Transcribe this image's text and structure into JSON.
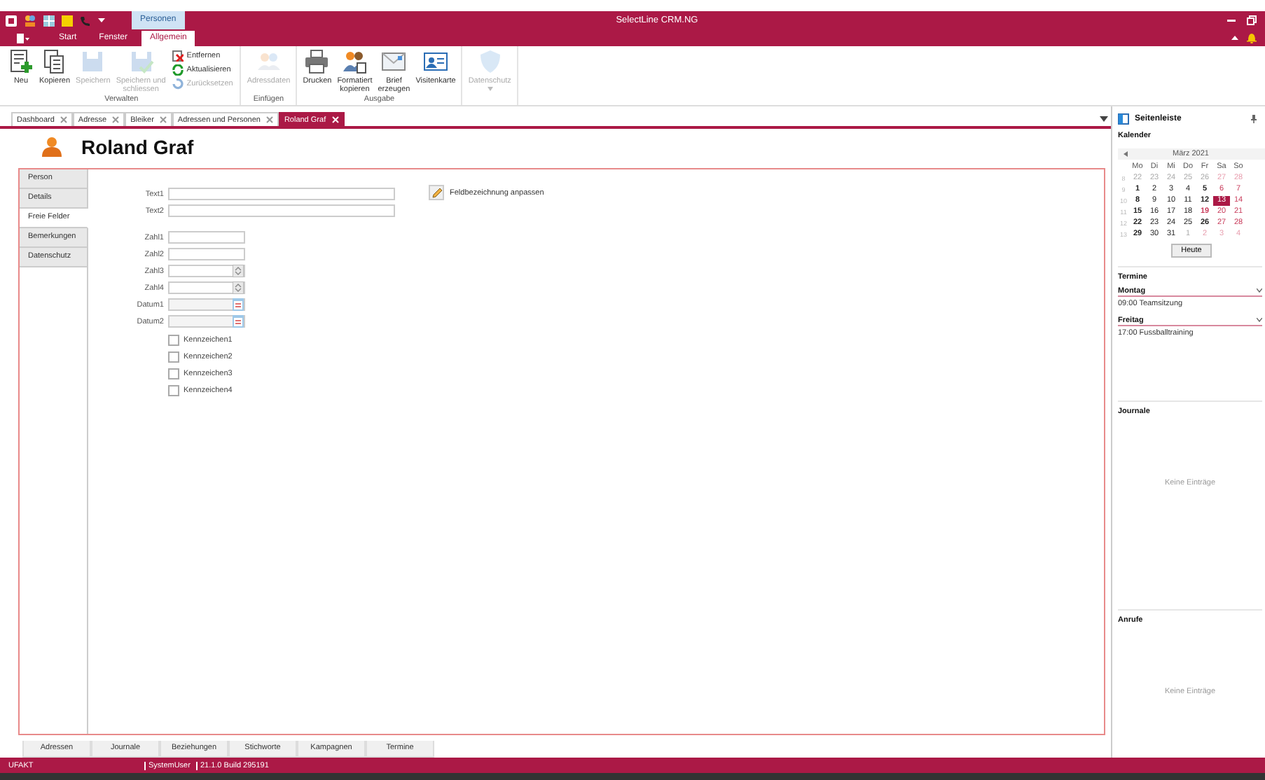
{
  "titlebar": {
    "title": "SelectLine CRM.NG",
    "context_tab": "Personen"
  },
  "ribbon_tabs": [
    {
      "label": "Start",
      "selected": false
    },
    {
      "label": "Fenster",
      "selected": false
    },
    {
      "label": "Allgemein",
      "selected": true
    }
  ],
  "ribbon_groups": [
    {
      "label": "Verwalten",
      "large": [
        {
          "lines": [
            "Neu"
          ],
          "disabled": false
        },
        {
          "lines": [
            "Kopieren"
          ],
          "disabled": false
        },
        {
          "lines": [
            "Speichern"
          ],
          "disabled": true
        },
        {
          "lines": [
            "Speichern und",
            "schliessen"
          ],
          "disabled": true
        }
      ],
      "small": [
        {
          "label": "Entfernen",
          "disabled": false
        },
        {
          "label": "Aktualisieren",
          "disabled": false
        },
        {
          "label": "Zurücksetzen",
          "disabled": true
        }
      ]
    },
    {
      "label": "Einfügen",
      "large": [
        {
          "lines": [
            "Adressdaten"
          ],
          "disabled": true
        }
      ]
    },
    {
      "label": "Ausgabe",
      "large": [
        {
          "lines": [
            "Drucken"
          ],
          "disabled": false
        },
        {
          "lines": [
            "Formatiert",
            "kopieren"
          ],
          "disabled": false
        },
        {
          "lines": [
            "Brief",
            "erzeugen"
          ],
          "disabled": false
        },
        {
          "lines": [
            "Visitenkarte"
          ],
          "disabled": false
        }
      ]
    },
    {
      "large": [
        {
          "lines": [
            "Datenschutz"
          ],
          "disabled": true
        }
      ]
    }
  ],
  "doc_tabs": [
    {
      "label": "Dashboard",
      "selected": false
    },
    {
      "label": "Adresse",
      "selected": false
    },
    {
      "label": "Bleiker",
      "selected": false
    },
    {
      "label": "Adressen und Personen",
      "selected": false
    },
    {
      "label": "Roland Graf",
      "selected": true
    }
  ],
  "record_title": "Roland Graf",
  "nav_tabs": [
    {
      "label": "Person",
      "selected": false
    },
    {
      "label": "Details",
      "selected": false
    },
    {
      "label": "Freie Felder",
      "selected": true
    },
    {
      "label": "Bemerkungen",
      "selected": false
    },
    {
      "label": "Datenschutz",
      "selected": false
    }
  ],
  "fields": [
    {
      "label": "Text1",
      "kind": "text"
    },
    {
      "label": "Text2",
      "kind": "text"
    },
    {
      "label": "Zahl1",
      "kind": "number"
    },
    {
      "label": "Zahl2",
      "kind": "number"
    },
    {
      "label": "Zahl3",
      "kind": "spin"
    },
    {
      "label": "Zahl4",
      "kind": "spin"
    },
    {
      "label": "Datum1",
      "kind": "date"
    },
    {
      "label": "Datum2",
      "kind": "date"
    }
  ],
  "checkboxes": [
    {
      "label": "Kennzeichen1",
      "checked": false
    },
    {
      "label": "Kennzeichen2",
      "checked": false
    },
    {
      "label": "Kennzeichen3",
      "checked": false
    },
    {
      "label": "Kennzeichen4",
      "checked": false
    }
  ],
  "rename_button": "Feldbezeichnung anpassen",
  "bottom_tabs": [
    "Adressen",
    "Journale",
    "Beziehungen",
    "Stichworte",
    "Kampagnen",
    "Termine"
  ],
  "sidebar": {
    "title": "Seitenleiste",
    "calendar": {
      "heading": "Kalender",
      "month": "März 2021",
      "weekdays": [
        "Mo",
        "Di",
        "Mi",
        "Do",
        "Fr",
        "Sa",
        "So"
      ],
      "weeks": [
        {
          "week": "8",
          "days": [
            {
              "d": "22",
              "muted": true,
              "bold": false,
              "red": false,
              "selected": false
            },
            {
              "d": "23",
              "muted": true,
              "bold": false,
              "red": false,
              "selected": false
            },
            {
              "d": "24",
              "muted": true,
              "bold": false,
              "red": false,
              "selected": false
            },
            {
              "d": "25",
              "muted": true,
              "bold": false,
              "red": false,
              "selected": false
            },
            {
              "d": "26",
              "muted": true,
              "bold": false,
              "red": false,
              "selected": false
            },
            {
              "d": "27",
              "muted": true,
              "bold": false,
              "red": true,
              "selected": false
            },
            {
              "d": "28",
              "muted": true,
              "bold": false,
              "red": true,
              "selected": false
            }
          ]
        },
        {
          "week": "9",
          "days": [
            {
              "d": "1",
              "muted": false,
              "bold": true,
              "red": false,
              "selected": false
            },
            {
              "d": "2",
              "muted": false,
              "bold": false,
              "red": false,
              "selected": false
            },
            {
              "d": "3",
              "muted": false,
              "bold": false,
              "red": false,
              "selected": false
            },
            {
              "d": "4",
              "muted": false,
              "bold": false,
              "red": false,
              "selected": false
            },
            {
              "d": "5",
              "muted": false,
              "bold": true,
              "red": false,
              "selected": false
            },
            {
              "d": "6",
              "muted": false,
              "bold": false,
              "red": true,
              "selected": false
            },
            {
              "d": "7",
              "muted": false,
              "bold": false,
              "red": true,
              "selected": false
            }
          ]
        },
        {
          "week": "10",
          "days": [
            {
              "d": "8",
              "muted": false,
              "bold": true,
              "red": false,
              "selected": false
            },
            {
              "d": "9",
              "muted": false,
              "bold": false,
              "red": false,
              "selected": false
            },
            {
              "d": "10",
              "muted": false,
              "bold": false,
              "red": false,
              "selected": false
            },
            {
              "d": "11",
              "muted": false,
              "bold": false,
              "red": false,
              "selected": false
            },
            {
              "d": "12",
              "muted": false,
              "bold": true,
              "red": false,
              "selected": false
            },
            {
              "d": "13",
              "muted": false,
              "bold": false,
              "red": true,
              "selected": true
            },
            {
              "d": "14",
              "muted": false,
              "bold": false,
              "red": true,
              "selected": false
            }
          ]
        },
        {
          "week": "11",
          "days": [
            {
              "d": "15",
              "muted": false,
              "bold": true,
              "red": false,
              "selected": false
            },
            {
              "d": "16",
              "muted": false,
              "bold": false,
              "red": false,
              "selected": false
            },
            {
              "d": "17",
              "muted": false,
              "bold": false,
              "red": false,
              "selected": false
            },
            {
              "d": "18",
              "muted": false,
              "bold": false,
              "red": false,
              "selected": false
            },
            {
              "d": "19",
              "muted": false,
              "bold": true,
              "red": true,
              "selected": false
            },
            {
              "d": "20",
              "muted": false,
              "bold": false,
              "red": true,
              "selected": false
            },
            {
              "d": "21",
              "muted": false,
              "bold": false,
              "red": true,
              "selected": false
            }
          ]
        },
        {
          "week": "12",
          "days": [
            {
              "d": "22",
              "muted": false,
              "bold": true,
              "red": false,
              "selected": false
            },
            {
              "d": "23",
              "muted": false,
              "bold": false,
              "red": false,
              "selected": false
            },
            {
              "d": "24",
              "muted": false,
              "bold": false,
              "red": false,
              "selected": false
            },
            {
              "d": "25",
              "muted": false,
              "bold": false,
              "red": false,
              "selected": false
            },
            {
              "d": "26",
              "muted": false,
              "bold": true,
              "red": false,
              "selected": false
            },
            {
              "d": "27",
              "muted": false,
              "bold": false,
              "red": true,
              "selected": false
            },
            {
              "d": "28",
              "muted": false,
              "bold": false,
              "red": true,
              "selected": false
            }
          ]
        },
        {
          "week": "13",
          "days": [
            {
              "d": "29",
              "muted": false,
              "bold": true,
              "red": false,
              "selected": false
            },
            {
              "d": "30",
              "muted": false,
              "bold": false,
              "red": false,
              "selected": false
            },
            {
              "d": "31",
              "muted": false,
              "bold": false,
              "red": false,
              "selected": false
            },
            {
              "d": "1",
              "muted": true,
              "bold": false,
              "red": false,
              "selected": false
            },
            {
              "d": "2",
              "muted": true,
              "bold": false,
              "red": true,
              "selected": false
            },
            {
              "d": "3",
              "muted": true,
              "bold": false,
              "red": true,
              "selected": false
            },
            {
              "d": "4",
              "muted": true,
              "bold": false,
              "red": true,
              "selected": false
            }
          ]
        }
      ],
      "today_button": "Heute"
    },
    "appointments": {
      "heading": "Termine",
      "days": [
        {
          "day": "Montag",
          "expanded": true,
          "entries": [
            "09:00 Teamsitzung"
          ]
        },
        {
          "day": "Freitag",
          "expanded": true,
          "entries": [
            "17:00 Fussballtraining"
          ]
        }
      ]
    },
    "sections": [
      {
        "heading": "Journale",
        "empty": "Keine Einträge"
      },
      {
        "heading": "Anrufe",
        "empty": "Keine Einträge"
      }
    ]
  },
  "status_bar": [
    "UFAKT",
    "SystemUser",
    "21.1.0 Build 295191"
  ]
}
